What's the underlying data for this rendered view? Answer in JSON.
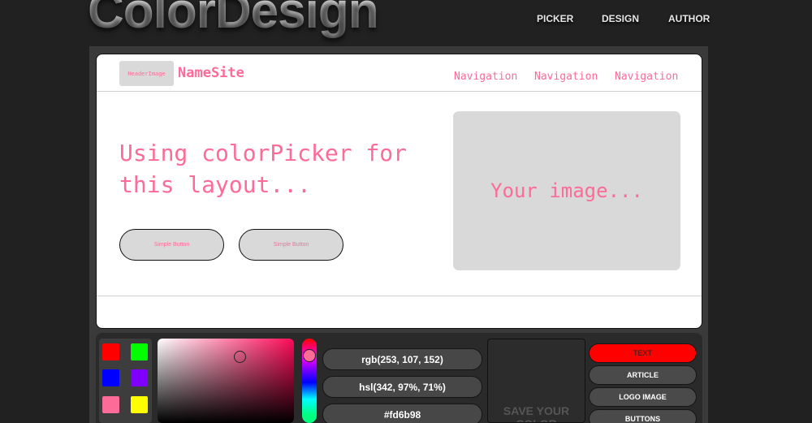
{
  "app": {
    "logo": "ColorDesign"
  },
  "topnav": [
    "PICKER",
    "DESIGN",
    "AUTHOR"
  ],
  "preview": {
    "header_image": "HeaderImage",
    "site_name": "NameSite",
    "nav": [
      "Navigation",
      "Navigation",
      "Navigation"
    ],
    "hero_text": "Using colorPicker for this layout...",
    "buttons": [
      "Simple Button",
      "Simple Button"
    ],
    "image_placeholder": "Your image...",
    "accent_color": "#fd6b98"
  },
  "picker": {
    "swatches": [
      "#ff0000",
      "#00ff00",
      "#0000ff",
      "#8000ff",
      "#fd6b98",
      "#ffff00"
    ],
    "rgb": "rgb(253, 107, 152)",
    "hsl": "hsl(342, 97%, 71%)",
    "hex": "#fd6b98",
    "save_label": "SAVE YOUR COLOR"
  },
  "targets": [
    "TEXT",
    "ARTICLE",
    "LOGO IMAGE",
    "BUTTONS"
  ],
  "active_target": "TEXT"
}
